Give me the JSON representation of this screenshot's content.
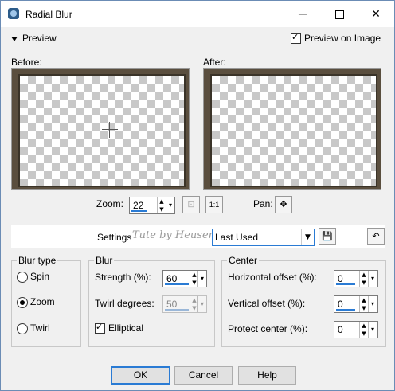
{
  "window": {
    "title": "Radial Blur",
    "icon": "app-icon"
  },
  "preview": {
    "toggle_label": "Preview",
    "preview_on_image_label": "Preview on Image",
    "preview_on_image_checked": true,
    "before_label": "Before:",
    "after_label": "After:"
  },
  "zoom": {
    "label": "Zoom:",
    "value": "22",
    "pan_label": "Pan:"
  },
  "settings": {
    "label": "Settings",
    "watermark": "Tute by Heusenhane",
    "preset_value": "Last Used"
  },
  "blur_type": {
    "title": "Blur type",
    "options": [
      {
        "label": "Spin",
        "selected": false
      },
      {
        "label": "Zoom",
        "selected": true
      },
      {
        "label": "Twirl",
        "selected": false
      }
    ]
  },
  "blur": {
    "title": "Blur",
    "strength_label": "Strength (%):",
    "strength_value": "60",
    "twirl_label": "Twirl degrees:",
    "twirl_value": "50",
    "elliptical_label": "Elliptical",
    "elliptical_checked": true
  },
  "center": {
    "title": "Center",
    "h_offset_label": "Horizontal offset (%):",
    "h_offset_value": "0",
    "v_offset_label": "Vertical offset (%):",
    "v_offset_value": "0",
    "protect_label": "Protect center (%):",
    "protect_value": "0"
  },
  "buttons": {
    "ok": "OK",
    "cancel": "Cancel",
    "help": "Help"
  },
  "accent_color": "#2a7bd4"
}
